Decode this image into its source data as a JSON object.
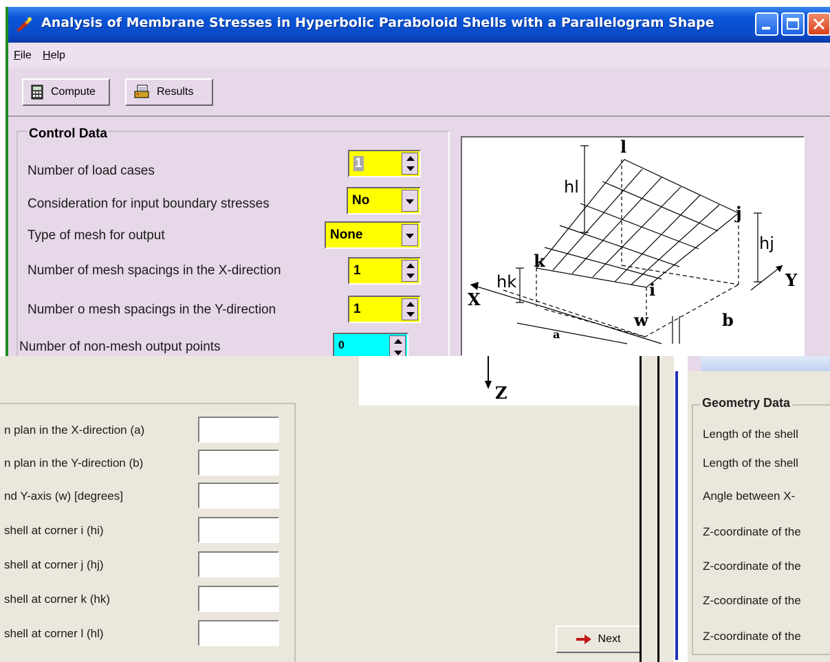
{
  "window": {
    "title": "Analysis of Membrane Stresses in Hyperbolic Paraboloid Shells with a Parallelogram Shape"
  },
  "menu": [
    "File",
    "Help"
  ],
  "toolbar": {
    "compute_label": "Compute",
    "results_label": "Results"
  },
  "control_data": {
    "title": "Control Data",
    "load_cases_label": "Number of load cases",
    "load_cases_value": "1",
    "boundary_label": "Consideration for input boundary stresses",
    "boundary_value": "No",
    "mesh_type_label": "Type of mesh for output",
    "mesh_type_value": "None",
    "mesh_x_label": "Number of mesh spacings in the X-direction",
    "mesh_x_value": "1",
    "mesh_y_label": "Number o mesh spacings in the Y-direction",
    "mesh_y_value": "1",
    "non_mesh_label": "Number of non-mesh output points",
    "non_mesh_value": "0"
  },
  "diagram": {
    "labels": [
      "l",
      "hl",
      "j",
      "hj",
      "k",
      "hk",
      "Y",
      "X",
      "i",
      "w",
      "b",
      "a",
      "Z"
    ]
  },
  "geometry_left": {
    "labels": [
      "n plan in the X-direction (a)",
      "n plan in the Y-direction (b)",
      "nd Y-axis (w) [degrees]",
      "shell at corner i (hi)",
      "shell at corner j (hj)",
      "shell at corner k (hk)",
      "shell at corner l (hl)"
    ]
  },
  "next_label": "Next",
  "geometry_right": {
    "title": "Geometry Data",
    "labels": [
      "Length of the shell",
      "Length of the shell",
      "Angle between X-",
      "Z-coordinate of the",
      "Z-coordinate of the",
      "Z-coordinate of the",
      "Z-coordinate of the"
    ]
  }
}
